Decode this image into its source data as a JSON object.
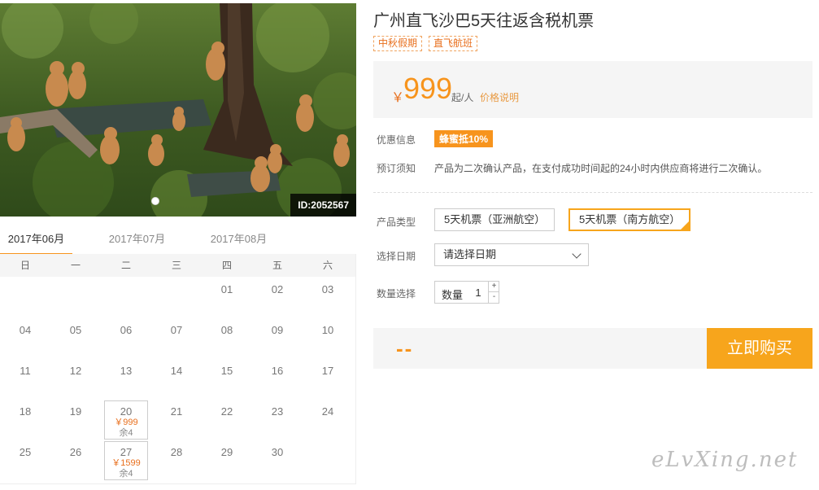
{
  "hero": {
    "photo_id": "ID:2052567",
    "slide_count": 1
  },
  "months": [
    {
      "label": "2017年06月",
      "active": true
    },
    {
      "label": "2017年07月",
      "active": false
    },
    {
      "label": "2017年08月",
      "active": false
    }
  ],
  "calendar": {
    "weekdays": [
      "日",
      "一",
      "二",
      "三",
      "四",
      "五",
      "六"
    ],
    "rows": [
      [
        {
          "day": ""
        },
        {
          "day": ""
        },
        {
          "day": ""
        },
        {
          "day": ""
        },
        {
          "day": "01"
        },
        {
          "day": "02"
        },
        {
          "day": "03"
        }
      ],
      [
        {
          "day": "04"
        },
        {
          "day": "05"
        },
        {
          "day": "06"
        },
        {
          "day": "07"
        },
        {
          "day": "08"
        },
        {
          "day": "09"
        },
        {
          "day": "10"
        }
      ],
      [
        {
          "day": "11"
        },
        {
          "day": "12"
        },
        {
          "day": "13"
        },
        {
          "day": "14"
        },
        {
          "day": "15"
        },
        {
          "day": "16"
        },
        {
          "day": "17"
        }
      ],
      [
        {
          "day": "18"
        },
        {
          "day": "19"
        },
        {
          "day": "20",
          "price": "￥999",
          "stock": "余4"
        },
        {
          "day": "21"
        },
        {
          "day": "22"
        },
        {
          "day": "23"
        },
        {
          "day": "24"
        }
      ],
      [
        {
          "day": "25"
        },
        {
          "day": "26"
        },
        {
          "day": "27",
          "price": "￥1599",
          "stock": "余4"
        },
        {
          "day": "28"
        },
        {
          "day": "29"
        },
        {
          "day": "30"
        },
        {
          "day": ""
        }
      ]
    ]
  },
  "product": {
    "title": "广州直飞沙巴5天往返含税机票",
    "tags": [
      "中秋假期",
      "直飞航班"
    ]
  },
  "price": {
    "currency": "￥",
    "value": "999",
    "unit": "起/人",
    "note": "价格说明"
  },
  "discount": {
    "label": "优惠信息",
    "badge": "蜂蜜抵10%"
  },
  "notice": {
    "label": "预订须知",
    "text": "产品为二次确认产品，在支付成功时间起的24小时内供应商将进行二次确认。"
  },
  "product_type": {
    "label": "产品类型",
    "options": [
      {
        "label": "5天机票（亚洲航空）",
        "selected": false
      },
      {
        "label": "5天机票（南方航空）",
        "selected": true
      }
    ]
  },
  "date_select": {
    "label": "选择日期",
    "value": "请选择日期"
  },
  "quantity": {
    "label": "数量选择",
    "inner_label": "数量",
    "value": "1",
    "plus": "+",
    "minus": "-"
  },
  "total": {
    "value": "--"
  },
  "buy_label": "立即购买",
  "watermark": "eLvXing.net",
  "colors": {
    "accent": "#f7941d",
    "accent_light": "#f7a51c",
    "price_red": "#e86f1d"
  }
}
